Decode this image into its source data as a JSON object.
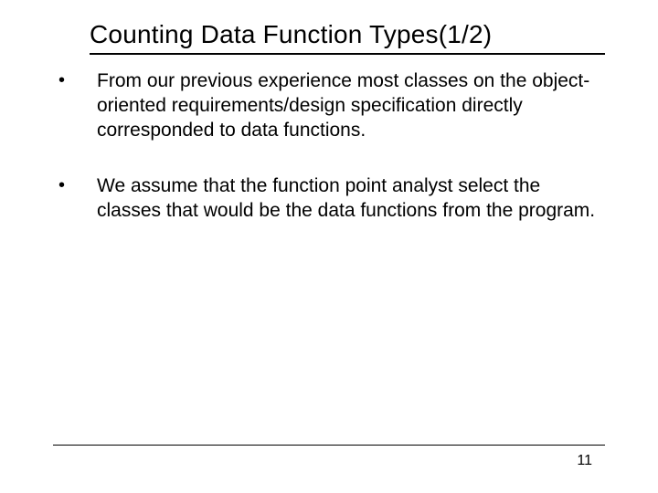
{
  "slide": {
    "title": "Counting Data Function Types(1/2)",
    "bullets": [
      "From our previous experience most classes on the object-oriented requirements/design specification directly corresponded to data functions.",
      "We assume that the function point analyst select the classes that would be the data functions from the program."
    ],
    "page_number": "11"
  }
}
